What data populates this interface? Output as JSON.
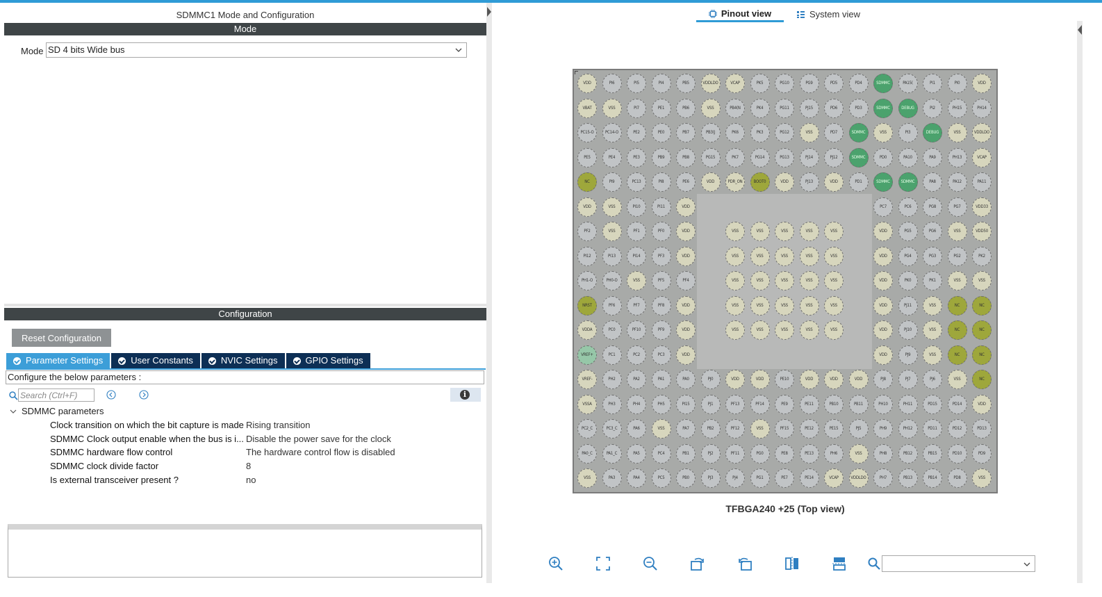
{
  "left_panel": {
    "title": "SDMMC1 Mode and Configuration",
    "mode_section": "Mode",
    "mode_label": "Mode",
    "mode_value": "SD 4 bits Wide bus",
    "config_section": "Configuration",
    "reset_button": "Reset Configuration",
    "tabs": [
      {
        "label": "Parameter Settings",
        "active": true
      },
      {
        "label": "User Constants",
        "active": false
      },
      {
        "label": "NVIC Settings",
        "active": false
      },
      {
        "label": "GPIO Settings",
        "active": false
      }
    ],
    "configure_hint": "Configure the below parameters :",
    "search_placeholder": "Search (Ctrl+F)",
    "group": "SDMMC parameters",
    "params": [
      {
        "key": "Clock transition on which the bit capture is made",
        "value": "Rising transition"
      },
      {
        "key": "SDMMC Clock output enable when the bus is i...",
        "value": "Disable the power save for the clock"
      },
      {
        "key": "SDMMC hardware flow control",
        "value": "The hardware control flow is disabled"
      },
      {
        "key": "SDMMC clock divide factor",
        "value": "8"
      },
      {
        "key": "Is external transceiver present ?",
        "value": "no"
      }
    ]
  },
  "right_panel": {
    "tab_pinout": "Pinout view",
    "tab_system": "System view",
    "package_label": "TFBGA240 +25 (Top view)",
    "zoom_value": "",
    "colors": {
      "io": "#c1c4c6",
      "power": "#d7d6bd",
      "nc": "#9ea73b",
      "assigned": "#4ba26d",
      "vref": "#96c7a8"
    },
    "pins": [
      [
        "VDD",
        "PI6",
        "PI5",
        "PI4",
        "PB5",
        "VDDLDO",
        "VCAP",
        "PK5",
        "PG10",
        "PG9",
        "PD5",
        "PD4",
        "SDMMC",
        "PA15(",
        "PI1",
        "PI0",
        "VDD"
      ],
      [
        "VBAT",
        "VSS",
        "PI7",
        "PE1",
        "PB6",
        "VSS",
        "PB4(N",
        "PK4",
        "PG11",
        "PJ15",
        "PD6",
        "PD3",
        "SDMMC",
        "DEBUG",
        "PI2",
        "PH15",
        "PH14"
      ],
      [
        "PC15-O",
        "PC14-O",
        "PE2",
        "PE0",
        "PB7",
        "PB3(J",
        "PK6",
        "PK3",
        "PG12",
        "VSS",
        "PD7",
        "SDMMC",
        "VSS",
        "PI3",
        "DEBUG",
        "VSS",
        "VDDLDO"
      ],
      [
        "PE5",
        "PE4",
        "PE3",
        "PB9",
        "PB8",
        "PG15",
        "PK7",
        "PG14",
        "PG13",
        "PJ14",
        "PJ12",
        "SDMMC",
        "PD0",
        "PA10",
        "PA9",
        "PH13",
        "VCAP"
      ],
      [
        "NC",
        "PI9",
        "PC13",
        "PI8",
        "PE6",
        "VDD",
        "PDR_ON",
        "BOOT0",
        "VDD",
        "PJ13",
        "VDD",
        "PD1",
        "SDMMC",
        "SDMMC",
        "PA8",
        "PA12",
        "PA11"
      ],
      [
        "VDD",
        "VSS",
        "PI10",
        "PI11",
        "VDD",
        "",
        "",
        "",
        "",
        "",
        "",
        "",
        "PC7",
        "PC6",
        "PG8",
        "PG7",
        "VDD33"
      ],
      [
        "PF2",
        "VSS",
        "PF1",
        "PF0",
        "VDD",
        "",
        "VSS",
        "VSS",
        "VSS",
        "VSS",
        "VSS",
        "",
        "VDD",
        "PG5",
        "PG6",
        "VSS",
        "VDD50"
      ],
      [
        "PI12",
        "PI13",
        "PI14",
        "PF3",
        "VDD",
        "",
        "VSS",
        "VSS",
        "VSS",
        "VSS",
        "VSS",
        "",
        "VDD",
        "PG4",
        "PG3",
        "PG2",
        "PK2"
      ],
      [
        "PH1-O",
        "PH0-O",
        "VSS",
        "PF5",
        "PF4",
        "",
        "VSS",
        "VSS",
        "VSS",
        "VSS",
        "VSS",
        "",
        "VDD",
        "PK0",
        "PK1",
        "VSS",
        "VSS"
      ],
      [
        "NRST",
        "PF6",
        "PF7",
        "PF8",
        "VDD",
        "",
        "VSS",
        "VSS",
        "VSS",
        "VSS",
        "VSS",
        "",
        "VDD",
        "PJ11",
        "VSS",
        "NC",
        "NC"
      ],
      [
        "VDDA",
        "PC0",
        "PF10",
        "PF9",
        "VDD",
        "",
        "VSS",
        "VSS",
        "VSS",
        "VSS",
        "VSS",
        "",
        "VDD",
        "PJ10",
        "VSS",
        "NC",
        "NC"
      ],
      [
        "VREF+",
        "PC1",
        "PC2",
        "PC3",
        "VDD",
        "",
        "",
        "",
        "",
        "",
        "",
        "",
        "VDD",
        "PJ9",
        "VSS",
        "NC",
        "NC"
      ],
      [
        "VREF-",
        "PH2",
        "PA2",
        "PA1",
        "PA0",
        "PJ0",
        "VDD",
        "VDD",
        "PE10",
        "VDD",
        "VDD",
        "VDD",
        "PJ8",
        "PJ7",
        "PJ6",
        "VSS",
        "NC"
      ],
      [
        "VSSA",
        "PH3",
        "PH4",
        "PH5",
        "PI15",
        "PJ1",
        "PF13",
        "PF14",
        "PE9",
        "PE11",
        "PB10",
        "PB11",
        "PH10",
        "PH11",
        "PD15",
        "PD14",
        "VDD"
      ],
      [
        "PC2_C",
        "PC3_C",
        "PA6",
        "VSS",
        "PA7",
        "PB2",
        "PF12",
        "VSS",
        "PF15",
        "PE12",
        "PE15",
        "PJ5",
        "PH9",
        "PH12",
        "PD11",
        "PD12",
        "PD13"
      ],
      [
        "PA0_C",
        "PA1_C",
        "PA5",
        "PC4",
        "PB1",
        "PJ2",
        "PF11",
        "PG0",
        "PE8",
        "PE13",
        "PH6",
        "VSS",
        "PH8",
        "PB12",
        "PB15",
        "PD10",
        "PD9"
      ],
      [
        "VSS",
        "PA3",
        "PA4",
        "PC5",
        "PB0",
        "PJ3",
        "PJ4",
        "PG1",
        "PE7",
        "PE14",
        "VCAP",
        "VDDLDO",
        "PH7",
        "PB13",
        "PB14",
        "PD8",
        "VSS"
      ]
    ]
  }
}
